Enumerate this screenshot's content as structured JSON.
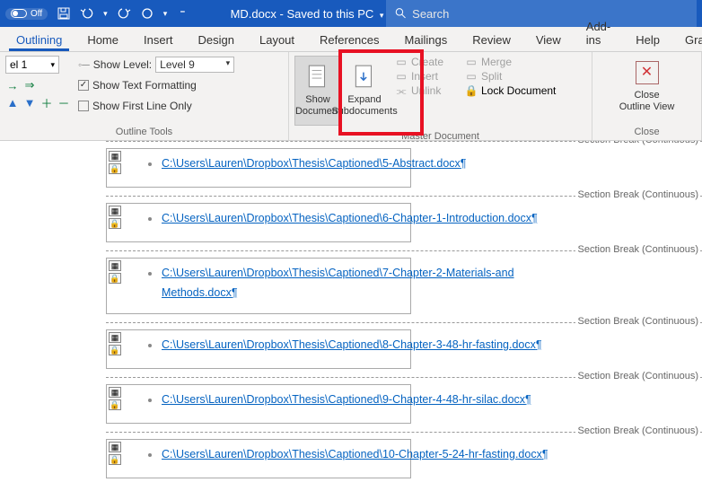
{
  "titlebar": {
    "autosave": "Off",
    "doc_title": "MD.docx",
    "save_status": "Saved to this PC",
    "search_placeholder": "Search"
  },
  "tabs": [
    "Outlining",
    "Home",
    "Insert",
    "Design",
    "Layout",
    "References",
    "Mailings",
    "Review",
    "View",
    "Add-ins",
    "Help",
    "Gra"
  ],
  "active_tab": "Outlining",
  "outline_tools": {
    "level_value": "el 1",
    "show_level_label": "Show Level:",
    "show_level_value": "Level 9",
    "show_formatting": "Show Text Formatting",
    "first_line_only": "Show First Line Only",
    "group_label": "Outline Tools"
  },
  "master": {
    "show_doc": "Show\nDocument",
    "expand": "Expand\nSubdocuments",
    "create": "Create",
    "insert": "Insert",
    "unlink": "Unlink",
    "merge": "Merge",
    "split": "Split",
    "lock": "Lock Document",
    "group_label": "Master Document"
  },
  "close": {
    "label": "Close\nOutline View",
    "group_label": "Close"
  },
  "section_break_label": "Section Break (Continuous)",
  "subdocs": [
    {
      "path": "C:\\Users\\Lauren\\Dropbox\\Thesis\\Captioned\\5-Abstract.docx"
    },
    {
      "path": "C:\\Users\\Lauren\\Dropbox\\Thesis\\Captioned\\6-Chapter-1-Introduction.docx"
    },
    {
      "path": "C:\\Users\\Lauren\\Dropbox\\Thesis\\Captioned\\7-Chapter-2-Materials-and-Methods.docx"
    },
    {
      "path": "C:\\Users\\Lauren\\Dropbox\\Thesis\\Captioned\\8-Chapter-3-48-hr-fasting.docx"
    },
    {
      "path": "C:\\Users\\Lauren\\Dropbox\\Thesis\\Captioned\\9-Chapter-4-48-hr-silac.docx"
    },
    {
      "path": "C:\\Users\\Lauren\\Dropbox\\Thesis\\Captioned\\10-Chapter-5-24-hr-fasting.docx"
    }
  ]
}
